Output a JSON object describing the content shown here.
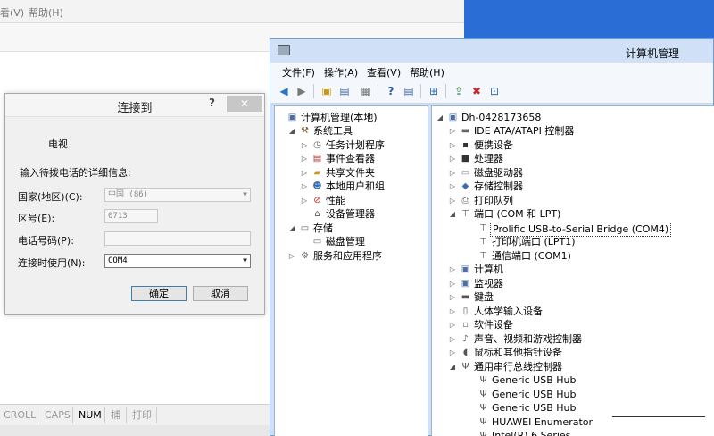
{
  "back_window": {
    "menu_view": "看(V)",
    "menu_help": "帮助(H)",
    "status": [
      "CROLL",
      "CAPS",
      "NUM",
      "捕",
      "打印"
    ]
  },
  "dialog": {
    "title": "连接到",
    "help": "?",
    "close": "✕",
    "name": "电视",
    "prompt": "输入待拨电话的详细信息:",
    "country_label": "国家(地区)(C):",
    "country_value": "中国 (86)",
    "area_label": "区号(E):",
    "area_value": "0713",
    "phone_label": "电话号码(P):",
    "phone_value": "",
    "connect_label": "连接时使用(N):",
    "connect_value": "COM4",
    "ok": "确定",
    "cancel": "取消"
  },
  "cm": {
    "title": "计算机管理",
    "menu": [
      "文件(F)",
      "操作(A)",
      "查看(V)",
      "帮助(H)"
    ],
    "left_tree": [
      {
        "label": "计算机管理(本地)",
        "icon": "computer-mgmt-icon"
      },
      {
        "label": "系统工具",
        "icon": "tools-icon"
      },
      {
        "label": "任务计划程序",
        "icon": "clock-icon"
      },
      {
        "label": "事件查看器",
        "icon": "event-viewer-icon"
      },
      {
        "label": "共享文件夹",
        "icon": "shared-folder-icon"
      },
      {
        "label": "本地用户和组",
        "icon": "users-icon"
      },
      {
        "label": "性能",
        "icon": "performance-icon"
      },
      {
        "label": "设备管理器",
        "icon": "device-manager-icon"
      },
      {
        "label": "存储",
        "icon": "storage-icon"
      },
      {
        "label": "磁盘管理",
        "icon": "disk-icon"
      },
      {
        "label": "服务和应用程序",
        "icon": "services-icon"
      }
    ],
    "right_tree": [
      {
        "label": "Dh-0428173658",
        "icon": "computer-icon"
      },
      {
        "label": "IDE ATA/ATAPI 控制器",
        "icon": "ide-icon"
      },
      {
        "label": "便携设备",
        "icon": "portable-icon"
      },
      {
        "label": "处理器",
        "icon": "cpu-icon"
      },
      {
        "label": "磁盘驱动器",
        "icon": "disk-drive-icon"
      },
      {
        "label": "存储控制器",
        "icon": "storage-ctrl-icon"
      },
      {
        "label": "打印队列",
        "icon": "printer-icon"
      },
      {
        "label": "端口 (COM 和 LPT)",
        "icon": "port-icon"
      },
      {
        "label": "Prolific USB-to-Serial Bridge (COM4)",
        "icon": "port-icon"
      },
      {
        "label": "打印机端口 (LPT1)",
        "icon": "port-icon"
      },
      {
        "label": "通信端口 (COM1)",
        "icon": "port-icon"
      },
      {
        "label": "计算机",
        "icon": "computer-icon"
      },
      {
        "label": "监视器",
        "icon": "monitor-icon"
      },
      {
        "label": "键盘",
        "icon": "keyboard-icon"
      },
      {
        "label": "人体学输入设备",
        "icon": "hid-icon"
      },
      {
        "label": "软件设备",
        "icon": "software-icon"
      },
      {
        "label": "声音、视频和游戏控制器",
        "icon": "sound-icon"
      },
      {
        "label": "鼠标和其他指针设备",
        "icon": "mouse-icon"
      },
      {
        "label": "通用串行总线控制器",
        "icon": "usb-icon"
      },
      {
        "label": "Generic USB Hub",
        "icon": "usb-icon"
      },
      {
        "label": "Generic USB Hub",
        "icon": "usb-icon"
      },
      {
        "label": "Generic USB Hub",
        "icon": "usb-icon"
      },
      {
        "label": "HUAWEI Enumerator",
        "icon": "usb-icon"
      },
      {
        "label": "Intel(R) 6 Series",
        "icon": "usb-icon"
      }
    ]
  }
}
